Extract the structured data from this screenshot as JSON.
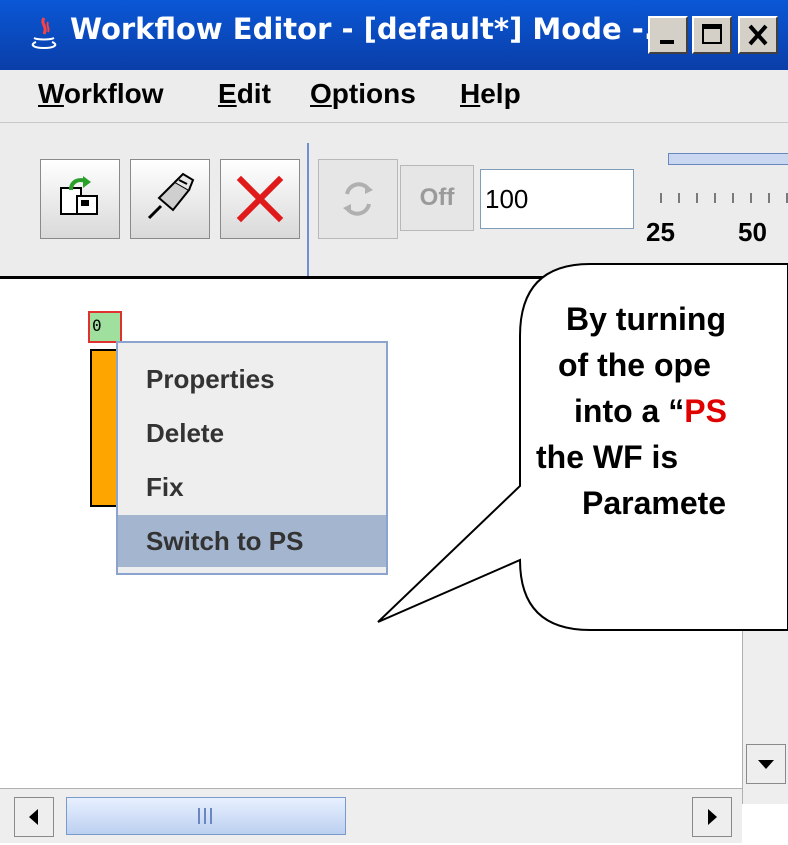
{
  "window": {
    "title": "Workflow Editor - [default*] Mode -...",
    "controls": [
      "minimize",
      "maximize",
      "close"
    ]
  },
  "menu": {
    "items": [
      {
        "label": "Workflow",
        "mnemonic": "W"
      },
      {
        "label": "Edit",
        "mnemonic": "E"
      },
      {
        "label": "Options",
        "mnemonic": "O"
      },
      {
        "label": "Help",
        "mnemonic": "H"
      }
    ]
  },
  "toolbar": {
    "buttons": [
      "import-icon",
      "plug-icon",
      "delete-icon",
      "refresh-icon"
    ],
    "off_label": "Off",
    "zoom_value": "100",
    "slider_ticks": [
      "25",
      "50"
    ]
  },
  "canvas": {
    "node_label": "0",
    "context_menu": {
      "items": [
        "Properties",
        "Delete",
        "Fix",
        "Switch to PS"
      ],
      "selected": "Switch to PS"
    }
  },
  "callout": {
    "lines": [
      {
        "pre": "By turning",
        "red": "",
        "post": ""
      },
      {
        "pre": "of the ope",
        "red": "",
        "post": ""
      },
      {
        "pre": "into a “",
        "red": "PS",
        "post": ""
      },
      {
        "pre": "the WF is",
        "red": "",
        "post": ""
      },
      {
        "pre": "Paramete",
        "red": "",
        "post": ""
      }
    ]
  },
  "colors": {
    "titlebar": "#0a57d6",
    "node": "#ffa500",
    "menu_selection": "#a4b6cf",
    "highlight_red": "#e00000"
  }
}
